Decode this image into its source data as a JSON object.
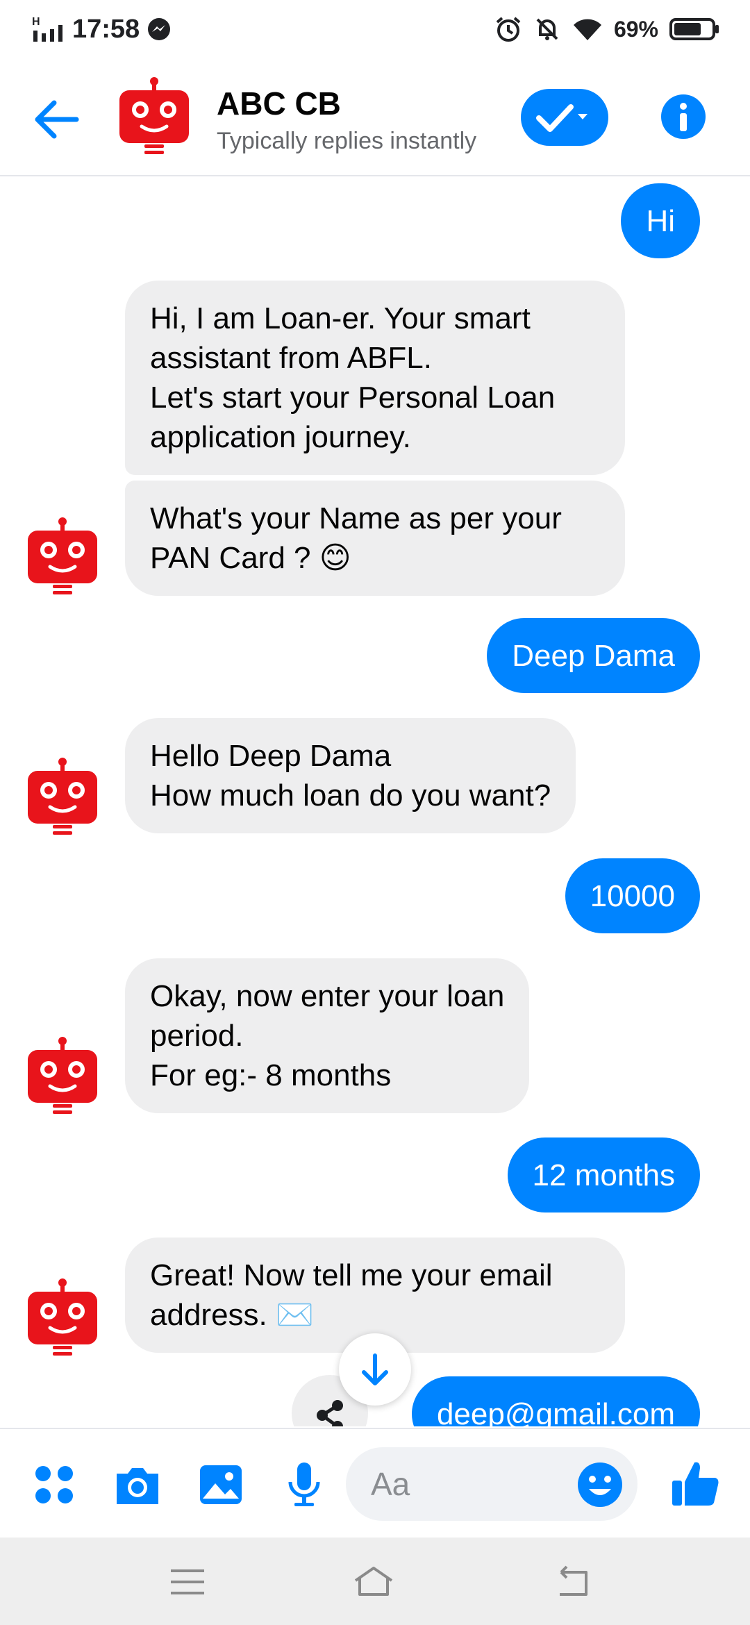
{
  "status_bar": {
    "network": "H",
    "time": "17:58",
    "battery": "69%",
    "icons": [
      "signal-icon",
      "messenger-icon",
      "alarm-icon",
      "mute-icon",
      "wifi-icon",
      "battery-icon"
    ]
  },
  "header": {
    "title": "ABC CB",
    "subtitle": "Typically replies instantly",
    "icons": [
      "back-arrow-icon",
      "checkmark-icon",
      "info-icon"
    ]
  },
  "messages": [
    {
      "from": "user",
      "lines": [
        "Hi"
      ]
    },
    {
      "from": "bot",
      "lines": [
        "Hi, I am Loan-er. Your smart",
        "assistant from ABFL.",
        "Let's start your Personal Loan",
        "application journey."
      ]
    },
    {
      "from": "bot",
      "lines": [
        "What's your Name as per your",
        "PAN Card ? 😊"
      ]
    },
    {
      "from": "user",
      "lines": [
        "Deep Dama"
      ]
    },
    {
      "from": "bot",
      "lines": [
        "Hello Deep Dama",
        "How much loan do you want?"
      ]
    },
    {
      "from": "user",
      "lines": [
        "10000"
      ]
    },
    {
      "from": "bot",
      "lines": [
        "Okay, now enter your loan",
        "period.",
        "For eg:-  8 months"
      ]
    },
    {
      "from": "user",
      "lines": [
        "12 months"
      ]
    },
    {
      "from": "bot",
      "lines": [
        "Great! Now tell me your email",
        "address. ✉️"
      ]
    },
    {
      "from": "user",
      "lines": [
        "deep@gmail.com"
      ]
    }
  ],
  "composer": {
    "placeholder": "Aa",
    "icons": [
      "apps-icon",
      "camera-icon",
      "image-icon",
      "microphone-icon",
      "emoji-icon",
      "thumbs-up-icon"
    ]
  },
  "accent_color": "#0084ff",
  "bot_color": "#e8141b",
  "navbar": {
    "icons": [
      "menu-icon",
      "home-icon",
      "back-icon"
    ]
  }
}
